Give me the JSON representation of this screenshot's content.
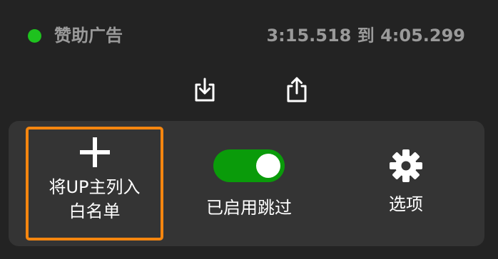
{
  "segment": {
    "category": "赞助广告",
    "time_range": "3:15.518 到 4:05.299",
    "status_color": "#1ec21e"
  },
  "toolbar": {
    "import_icon": "download-tray-icon",
    "export_icon": "share-upload-icon"
  },
  "actions": {
    "whitelist": {
      "line1": "将UP主列入",
      "line2": "白名单",
      "icon": "plus-icon"
    },
    "skip": {
      "label": "已启用跳过",
      "enabled": true,
      "toggle_color": "#0a9b0a"
    },
    "options": {
      "label": "选项",
      "icon": "gear-icon"
    }
  }
}
